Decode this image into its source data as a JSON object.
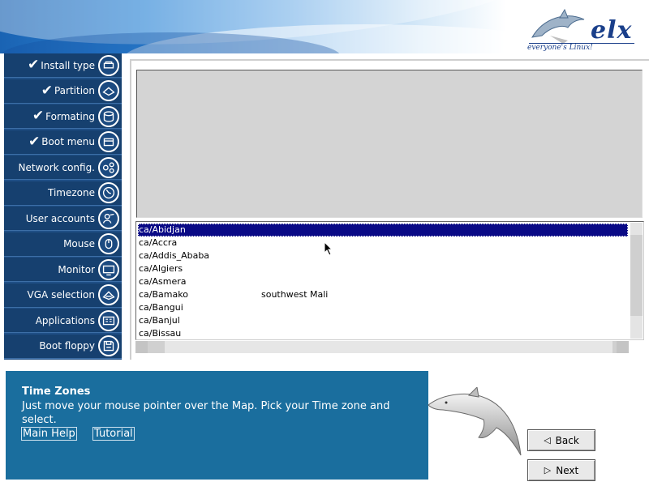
{
  "logo": {
    "name": "elx",
    "tagline": "everyone's Linux!"
  },
  "sidebar": {
    "items": [
      {
        "label": "Install type",
        "done": true,
        "icon": "install-icon"
      },
      {
        "label": "Partition",
        "done": true,
        "icon": "partition-icon"
      },
      {
        "label": "Formating",
        "done": true,
        "icon": "format-icon"
      },
      {
        "label": "Boot menu",
        "done": true,
        "icon": "boot-menu-icon"
      },
      {
        "label": "Network config.",
        "done": false,
        "icon": "network-icon"
      },
      {
        "label": "Timezone",
        "done": false,
        "icon": "clock-icon"
      },
      {
        "label": "User accounts",
        "done": false,
        "icon": "users-icon"
      },
      {
        "label": "Mouse",
        "done": false,
        "icon": "mouse-icon"
      },
      {
        "label": "Monitor",
        "done": false,
        "icon": "monitor-icon"
      },
      {
        "label": "VGA selection",
        "done": false,
        "icon": "vga-icon"
      },
      {
        "label": "Applications",
        "done": false,
        "icon": "applications-icon"
      },
      {
        "label": "Boot floppy",
        "done": false,
        "icon": "floppy-icon"
      }
    ]
  },
  "timezones": [
    {
      "name": "ca/Abidjan",
      "desc": "",
      "selected": true
    },
    {
      "name": "ca/Accra",
      "desc": "",
      "selected": false
    },
    {
      "name": "ca/Addis_Ababa",
      "desc": "",
      "selected": false
    },
    {
      "name": "ca/Algiers",
      "desc": "",
      "selected": false
    },
    {
      "name": "ca/Asmera",
      "desc": "",
      "selected": false
    },
    {
      "name": "ca/Bamako",
      "desc": "southwest Mali",
      "selected": false
    },
    {
      "name": "ca/Bangui",
      "desc": "",
      "selected": false
    },
    {
      "name": "ca/Banjul",
      "desc": "",
      "selected": false
    },
    {
      "name": "ca/Bissau",
      "desc": "",
      "selected": false
    }
  ],
  "help": {
    "title": "Time Zones",
    "text": "Just move your mouse pointer over the Map. Pick your Time zone and select.",
    "main_help": "Main Help",
    "tutorial": "Tutorial"
  },
  "buttons": {
    "back": "Back",
    "next": "Next"
  },
  "colors": {
    "sidebar_bg": "#16406f",
    "help_bg": "#1a6e9e",
    "selection": "#0a0a86"
  }
}
